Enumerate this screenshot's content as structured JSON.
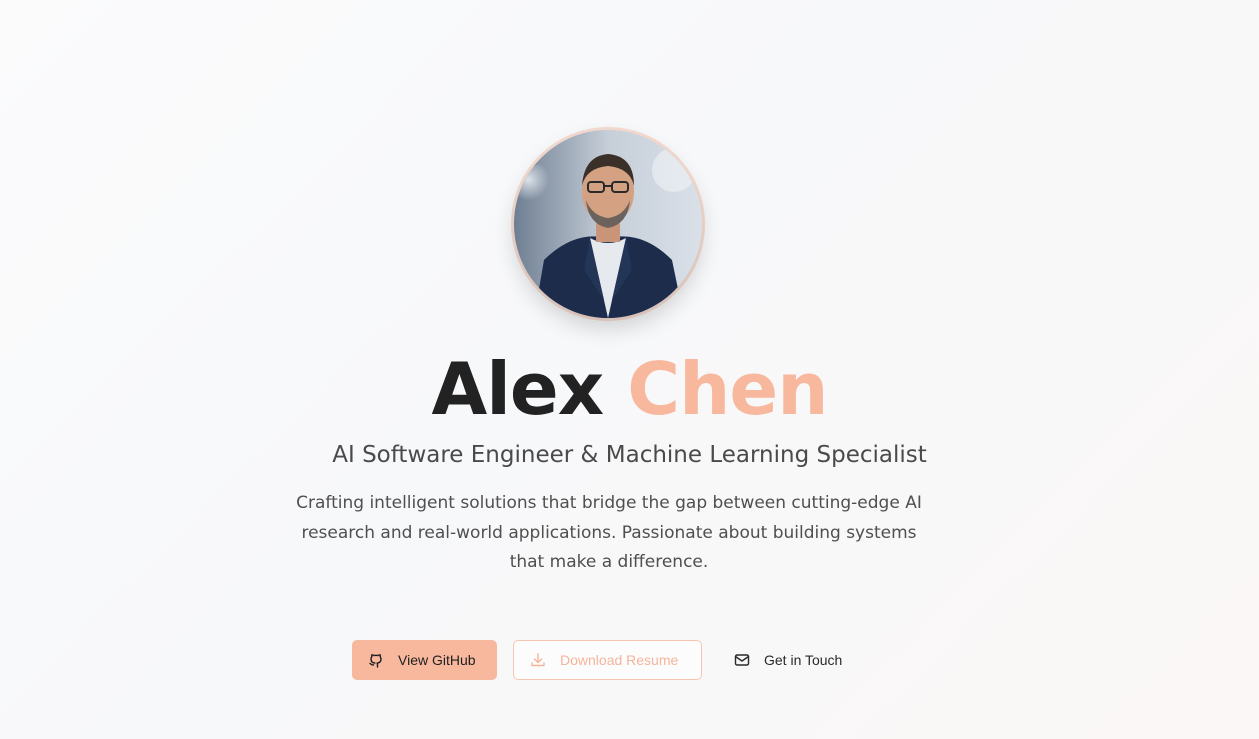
{
  "profile": {
    "first_name": "Alex",
    "last_name": "Chen",
    "title": "AI Software Engineer & Machine Learning Specialist",
    "description": "Crafting intelligent solutions that bridge the gap between cutting-edge AI research and real-world applications. Passionate about building systems that make a difference.",
    "avatar_icon": "profile-photo"
  },
  "actions": {
    "github_label": "View GitHub",
    "github_icon": "github-icon",
    "resume_label": "Download Resume",
    "resume_icon": "download-icon",
    "contact_label": "Get in Touch",
    "contact_icon": "mail-icon"
  },
  "colors": {
    "accent": "#f8b89e",
    "text_dark": "#222222",
    "text_muted": "#4f4f4f"
  }
}
